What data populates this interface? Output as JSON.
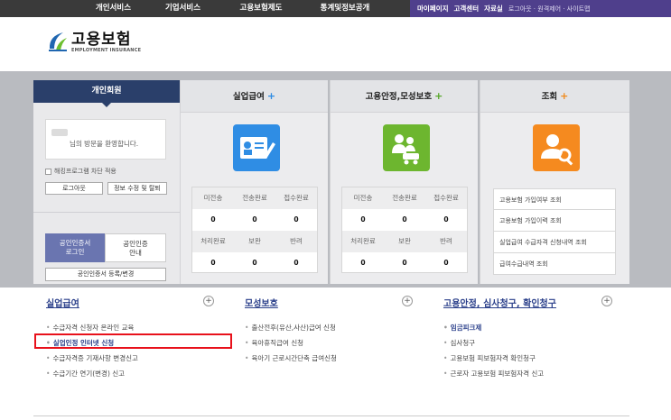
{
  "topnav": {
    "main": [
      "개인서비스",
      "기업서비스",
      "고용보험제도",
      "통계및정보공개"
    ],
    "util": [
      "마이페이지",
      "고객센터",
      "자료실"
    ],
    "util_light": "로그아웃 · 원격제어 · 사이트맵"
  },
  "logo": {
    "ko": "고용보험",
    "en": "EMPLOYMENT INSURANCE"
  },
  "login": {
    "tab": "개인회원",
    "welcome": "님의 방문을 환영합니다.",
    "popup_block": "해킹프로그램 차단 적용",
    "logout": "로그아웃",
    "edit_info": "정보 수정 및 탈퇴",
    "cert_login": [
      "공인인증서",
      "로그인"
    ],
    "cert_guide": [
      "공인인증",
      "안내"
    ],
    "cert_register": "공인인증서 등록/변경"
  },
  "services": [
    {
      "title": "실업급여",
      "plus_color": "#2f8de4",
      "icon": "id-card-icon",
      "headers1": [
        "미전송",
        "전송완료",
        "접수완료"
      ],
      "values1": [
        "0",
        "0",
        "0"
      ],
      "headers2": [
        "처리완료",
        "보완",
        "반려"
      ],
      "values2": [
        "0",
        "0",
        "0"
      ]
    },
    {
      "title": "고용안정,모성보호",
      "plus_color": "#58a82b",
      "icon": "family-stroller-icon",
      "headers1": [
        "미전송",
        "전송완료",
        "접수완료"
      ],
      "values1": [
        "0",
        "0",
        "0"
      ],
      "headers2": [
        "처리완료",
        "보완",
        "반려"
      ],
      "values2": [
        "0",
        "0",
        "0"
      ]
    },
    {
      "title": "조회",
      "plus_color": "#f08a1c",
      "icon": "user-search-icon",
      "lookup": [
        "고용보험 가입여부 조회",
        "고용보험 가입이력 조회",
        "실업급여 수급자격 신청내역 조회",
        "급여수급내역 조회"
      ]
    }
  ],
  "sections": [
    {
      "title": "실업급여",
      "items": [
        "수급자격 신청자 온라인 교육",
        "실업인정 인터넷 신청",
        "수급자격증 기재사항 변경신고",
        "수급기간 연기(변경) 신고"
      ]
    },
    {
      "title": "모성보호",
      "items": [
        "출산전후(유산,사산)급여 신청",
        "육아휴직급여 신청",
        "육아기 근로시간단축 급여신청"
      ]
    },
    {
      "title": "고용안정, 심사청구, 확인청구",
      "items": [
        "임금피크제",
        "심사청구",
        "고용보험 피보험자격 확인청구",
        "근로자 고용보험 피보험자격 신고"
      ]
    }
  ],
  "colors": {
    "nav_bg": "#3a3a3a",
    "util_bg": "#4f3f8c",
    "accent": "#2a3f6a",
    "highlight_box": "#e8111b"
  }
}
